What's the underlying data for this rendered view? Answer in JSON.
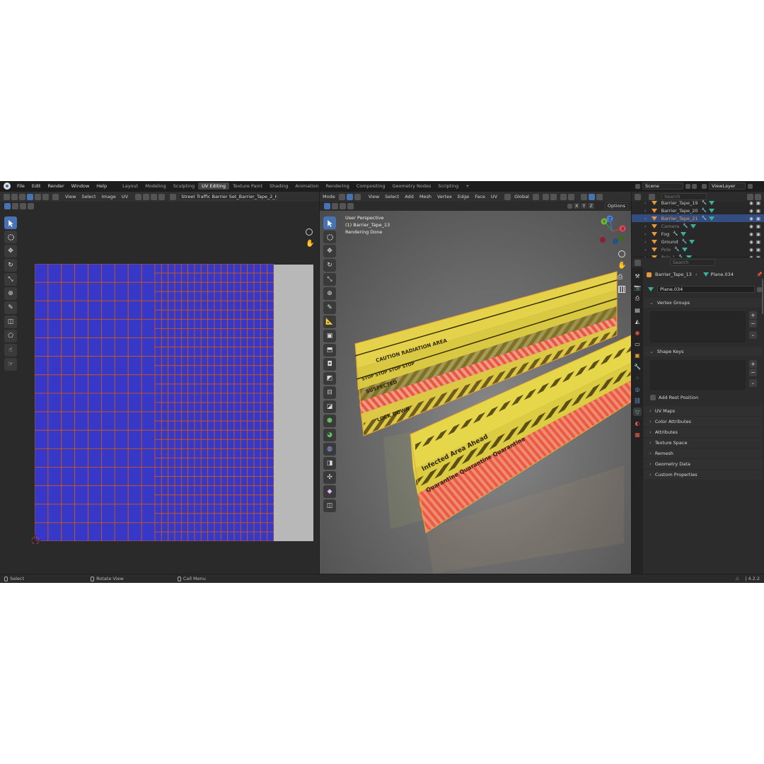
{
  "menu": [
    "File",
    "Edit",
    "Render",
    "Window",
    "Help"
  ],
  "workspaces": [
    {
      "label": "Layout",
      "active": false
    },
    {
      "label": "Modeling",
      "active": false
    },
    {
      "label": "Sculpting",
      "active": false
    },
    {
      "label": "UV Editing",
      "active": true
    },
    {
      "label": "Texture Paint",
      "active": false
    },
    {
      "label": "Shading",
      "active": false
    },
    {
      "label": "Animation",
      "active": false
    },
    {
      "label": "Rendering",
      "active": false
    },
    {
      "label": "Compositing",
      "active": false
    },
    {
      "label": "Geometry Nodes",
      "active": false
    },
    {
      "label": "Scripting",
      "active": false
    }
  ],
  "add_workspace": "+",
  "uv_editor": {
    "menus": [
      "View",
      "Select",
      "Image",
      "UV"
    ],
    "image_name": "Street Traffic Barrier Set_Barrier_Tape_2_Heig"
  },
  "viewport": {
    "mode": "Mode",
    "menus": [
      "View",
      "Select",
      "Add",
      "Mesh",
      "Vertex",
      "Edge",
      "Face",
      "UV"
    ],
    "orientation": "Global",
    "axes": [
      "X",
      "Y",
      "Z"
    ],
    "options": "Options",
    "overlay": {
      "line1": "User Perspective",
      "line2": "(1) Barrier_Tape_13",
      "line3": "Rendering Done"
    },
    "gizmo": {
      "x": "X",
      "y": "Y",
      "z": "Z"
    },
    "tape_texts": [
      "CAUTION RADIATION AREA",
      "STOP STOP STOP STOP",
      "SUSPECTED",
      "LOCK DOWN",
      "Infected Area Ahead",
      "Quarantine Quarantine Quarantine"
    ]
  },
  "outliner": {
    "scene": "Scene",
    "view_layer": "ViewLayer",
    "search_placeholder": "Search",
    "items": [
      {
        "label": "Barrier_Tape_19",
        "selected": false,
        "dim": false
      },
      {
        "label": "Barrier_Tape_20",
        "selected": false,
        "dim": false
      },
      {
        "label": "Barrier_Tape_21",
        "selected": true,
        "dim": false
      },
      {
        "label": "Camera",
        "selected": false,
        "dim": true
      },
      {
        "label": "Fog",
        "selected": false,
        "dim": false
      },
      {
        "label": "Ground",
        "selected": false,
        "dim": false
      },
      {
        "label": "Pole",
        "selected": false,
        "dim": true
      },
      {
        "label": "Pole.1",
        "selected": false,
        "dim": true
      }
    ]
  },
  "properties": {
    "search_placeholder": "Search",
    "object_name": "Barrier_Tape_13",
    "mesh_name": "Plane.034",
    "data_name": "Plane.034",
    "vertex_groups": "Vertex Groups",
    "shape_keys": "Shape Keys",
    "add_rest_position": "Add Rest Position",
    "collapsed_sections": [
      "UV Maps",
      "Color Attributes",
      "Attributes",
      "Texture Space",
      "Remesh",
      "Geometry Data",
      "Custom Properties"
    ]
  },
  "status": {
    "select": "Select",
    "rotate": "Rotate View",
    "call_menu": "Call Menu",
    "version": "4.2.2"
  },
  "colors": {
    "accent": "#4772b3",
    "uv_face": "#3737c8",
    "uv_edge": "#c0581e",
    "tape_yellow": "#e6d445",
    "tape_red": "#e8553f"
  }
}
